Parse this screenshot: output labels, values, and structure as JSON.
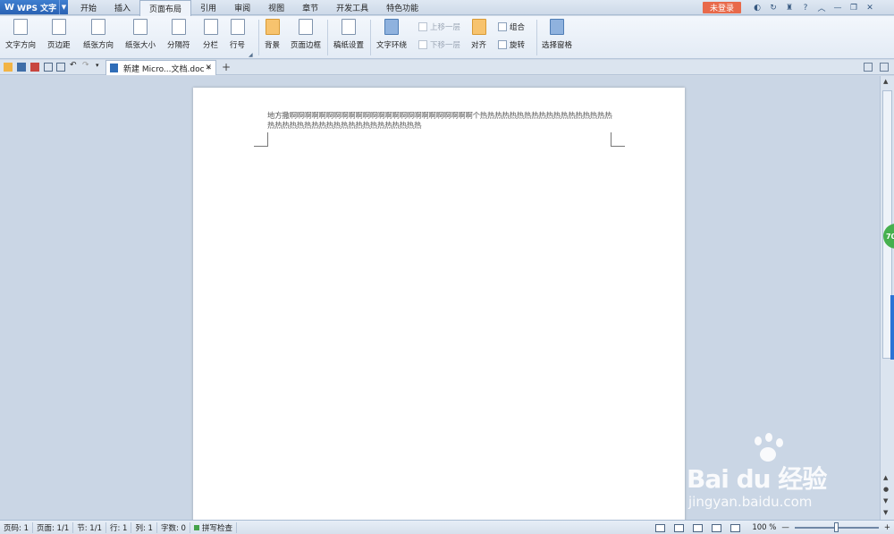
{
  "app": {
    "name": "WPS 文字"
  },
  "menu": {
    "tabs": [
      "开始",
      "插入",
      "页面布局",
      "引用",
      "审阅",
      "视图",
      "章节",
      "开发工具",
      "特色功能"
    ],
    "active": "页面布局",
    "login_label": "未登录",
    "help_label": "?"
  },
  "ribbon": {
    "text_direction": "文字方向",
    "margins": "页边距",
    "orientation": "纸张方向",
    "paper_size": "纸张大小",
    "breaks": "分隔符",
    "columns": "分栏",
    "line_numbers": "行号",
    "background": "背景",
    "page_border": "页面边框",
    "manuscript": "稿纸设置",
    "text_wrap": "文字环绕",
    "bring_forward": "上移一层",
    "send_backward": "下移一层",
    "align": "对齐",
    "group": "组合",
    "rotate": "旋转",
    "selection_pane": "选择窗格"
  },
  "document_tab": {
    "title": "新建 Micro...文档.doc *"
  },
  "document": {
    "text": "地方撒啊啊啊啊啊啊啊啊啊啊啊啊啊啊啊啊啊啊啊啊啊啊啊啊啊个热热热热热热热热热热热热热热热热热热热热热热热热热热热热热热热热热热热热热热热"
  },
  "side_badge": "70",
  "watermark": {
    "brand": "Bai du 经验",
    "url": "jingyan.baidu.com"
  },
  "statusbar": {
    "page": "页码: 1",
    "pages": "页面: 1/1",
    "section": "节: 1/1",
    "row": "行: 1",
    "col": "列: 1",
    "words": "字数: 0",
    "spellcheck": "拼写检查",
    "zoom": "100 %",
    "zoom_level": 0.5
  }
}
